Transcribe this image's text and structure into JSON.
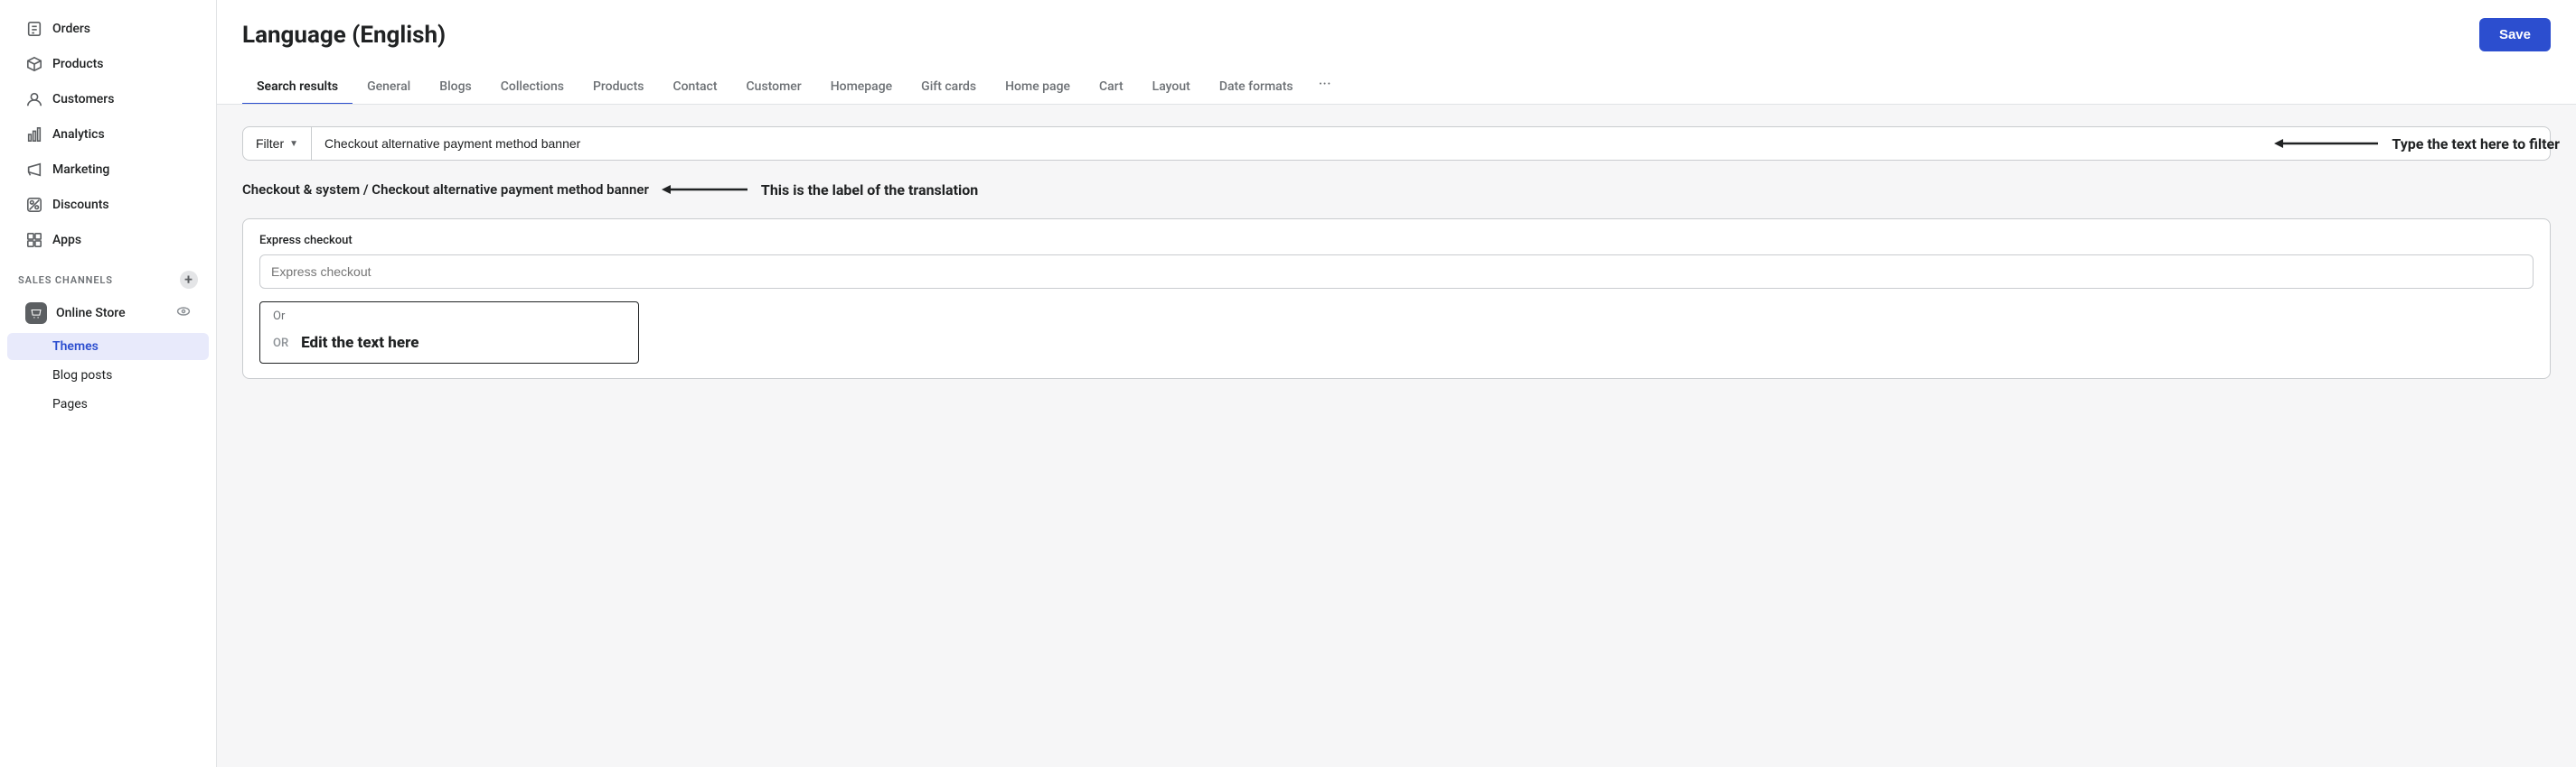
{
  "sidebar": {
    "nav_items": [
      {
        "id": "orders",
        "label": "Orders",
        "icon": "orders"
      },
      {
        "id": "products",
        "label": "Products",
        "icon": "products"
      },
      {
        "id": "customers",
        "label": "Customers",
        "icon": "customers"
      },
      {
        "id": "analytics",
        "label": "Analytics",
        "icon": "analytics"
      },
      {
        "id": "marketing",
        "label": "Marketing",
        "icon": "marketing"
      },
      {
        "id": "discounts",
        "label": "Discounts",
        "icon": "discounts"
      },
      {
        "id": "apps",
        "label": "Apps",
        "icon": "apps"
      }
    ],
    "sales_channels_label": "SALES CHANNELS",
    "online_store_label": "Online Store",
    "sub_items": [
      {
        "id": "themes",
        "label": "Themes",
        "active": true
      },
      {
        "id": "blog-posts",
        "label": "Blog posts",
        "active": false
      },
      {
        "id": "pages",
        "label": "Pages",
        "active": false
      }
    ]
  },
  "header": {
    "title": "Language (English)",
    "save_button_label": "Save"
  },
  "tabs": [
    {
      "id": "search-results",
      "label": "Search results",
      "active": true
    },
    {
      "id": "general",
      "label": "General",
      "active": false
    },
    {
      "id": "blogs",
      "label": "Blogs",
      "active": false
    },
    {
      "id": "collections",
      "label": "Collections",
      "active": false
    },
    {
      "id": "products-tab",
      "label": "Products",
      "active": false
    },
    {
      "id": "contact",
      "label": "Contact",
      "active": false
    },
    {
      "id": "customer",
      "label": "Customer",
      "active": false
    },
    {
      "id": "homepage",
      "label": "Homepage",
      "active": false
    },
    {
      "id": "gift-cards",
      "label": "Gift cards",
      "active": false
    },
    {
      "id": "home-page",
      "label": "Home page",
      "active": false
    },
    {
      "id": "cart",
      "label": "Cart",
      "active": false
    },
    {
      "id": "layout",
      "label": "Layout",
      "active": false
    },
    {
      "id": "date-formats",
      "label": "Date formats",
      "active": false
    }
  ],
  "filter": {
    "button_label": "Filter",
    "input_value": "Checkout alternative payment method banner",
    "annotation": "Type the text here to filter"
  },
  "translation": {
    "label": "Checkout & system / Checkout alternative payment method banner",
    "annotation": "This is the label of the translation"
  },
  "field": {
    "label": "Express checkout",
    "placeholder": "Express checkout"
  },
  "or_edit": {
    "or_label": "Or",
    "or_text": "OR",
    "edit_text": "Edit the text here"
  }
}
